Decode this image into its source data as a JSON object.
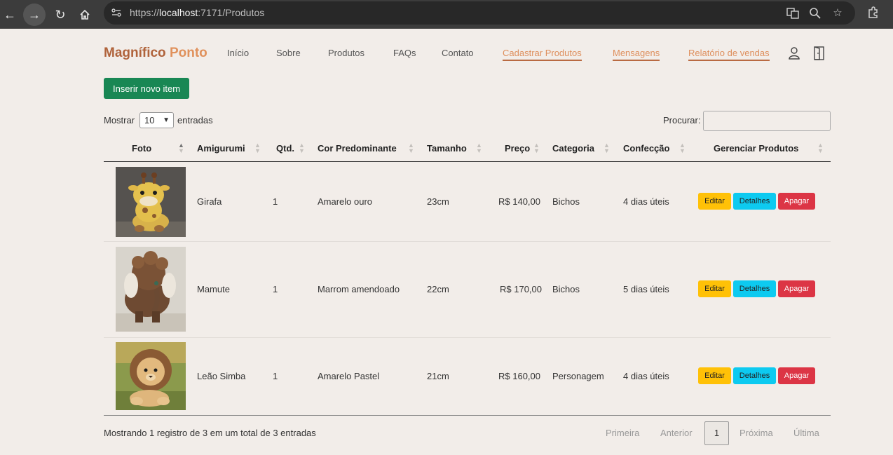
{
  "browser": {
    "url_prefix": "https://",
    "url_host": "localhost",
    "url_rest": ":7171/Produtos"
  },
  "brand": {
    "part1": "Magnífico",
    "part2": "Ponto"
  },
  "nav": [
    {
      "label": "Início"
    },
    {
      "label": "Sobre"
    },
    {
      "label": "Produtos"
    },
    {
      "label": "FAQs"
    },
    {
      "label": "Contato"
    },
    {
      "label": "Cadastrar Produtos"
    },
    {
      "label": "Mensagens"
    },
    {
      "label": "Relatório de vendas"
    }
  ],
  "insert_button": "Inserir novo item",
  "length": {
    "prefix": "Mostrar",
    "value": "10",
    "suffix": "entradas"
  },
  "search": {
    "label": "Procurar:"
  },
  "table": {
    "columns": [
      "Foto",
      "Amigurumi",
      "Qtd.",
      "Cor Predominante",
      "Tamanho",
      "Preço",
      "Categoria",
      "Confecção",
      "Gerenciar Produtos"
    ],
    "rows": [
      {
        "image": "giraffe-amigurumi-photo",
        "name": "Girafa",
        "qty": "1",
        "color": "Amarelo ouro",
        "size": "23cm",
        "price": "R$ 140,00",
        "category": "Bichos",
        "time": "4 dias úteis"
      },
      {
        "image": "mammoth-amigurumi-photo",
        "name": "Mamute",
        "qty": "1",
        "color": "Marrom amendoado",
        "size": "22cm",
        "price": "R$ 170,00",
        "category": "Bichos",
        "time": "5 dias úteis"
      },
      {
        "image": "lion-amigurumi-photo",
        "name": "Leão Simba",
        "qty": "1",
        "color": "Amarelo Pastel",
        "size": "21cm",
        "price": "R$ 160,00",
        "category": "Personagem",
        "time": "4 dias úteis"
      }
    ],
    "actions": {
      "edit": "Editar",
      "details": "Detalhes",
      "delete": "Apagar"
    }
  },
  "footer": {
    "info": "Mostrando 1 registro de 3 em um total de 3 entradas",
    "first": "Primeira",
    "prev": "Anterior",
    "current": "1",
    "next": "Próxima",
    "last": "Última"
  },
  "colors": {
    "brand_dark": "#b0633b",
    "brand_light": "#e0915c",
    "insert": "#198754",
    "edit": "#ffc107",
    "details": "#0dcaf0",
    "delete": "#dc3545"
  }
}
